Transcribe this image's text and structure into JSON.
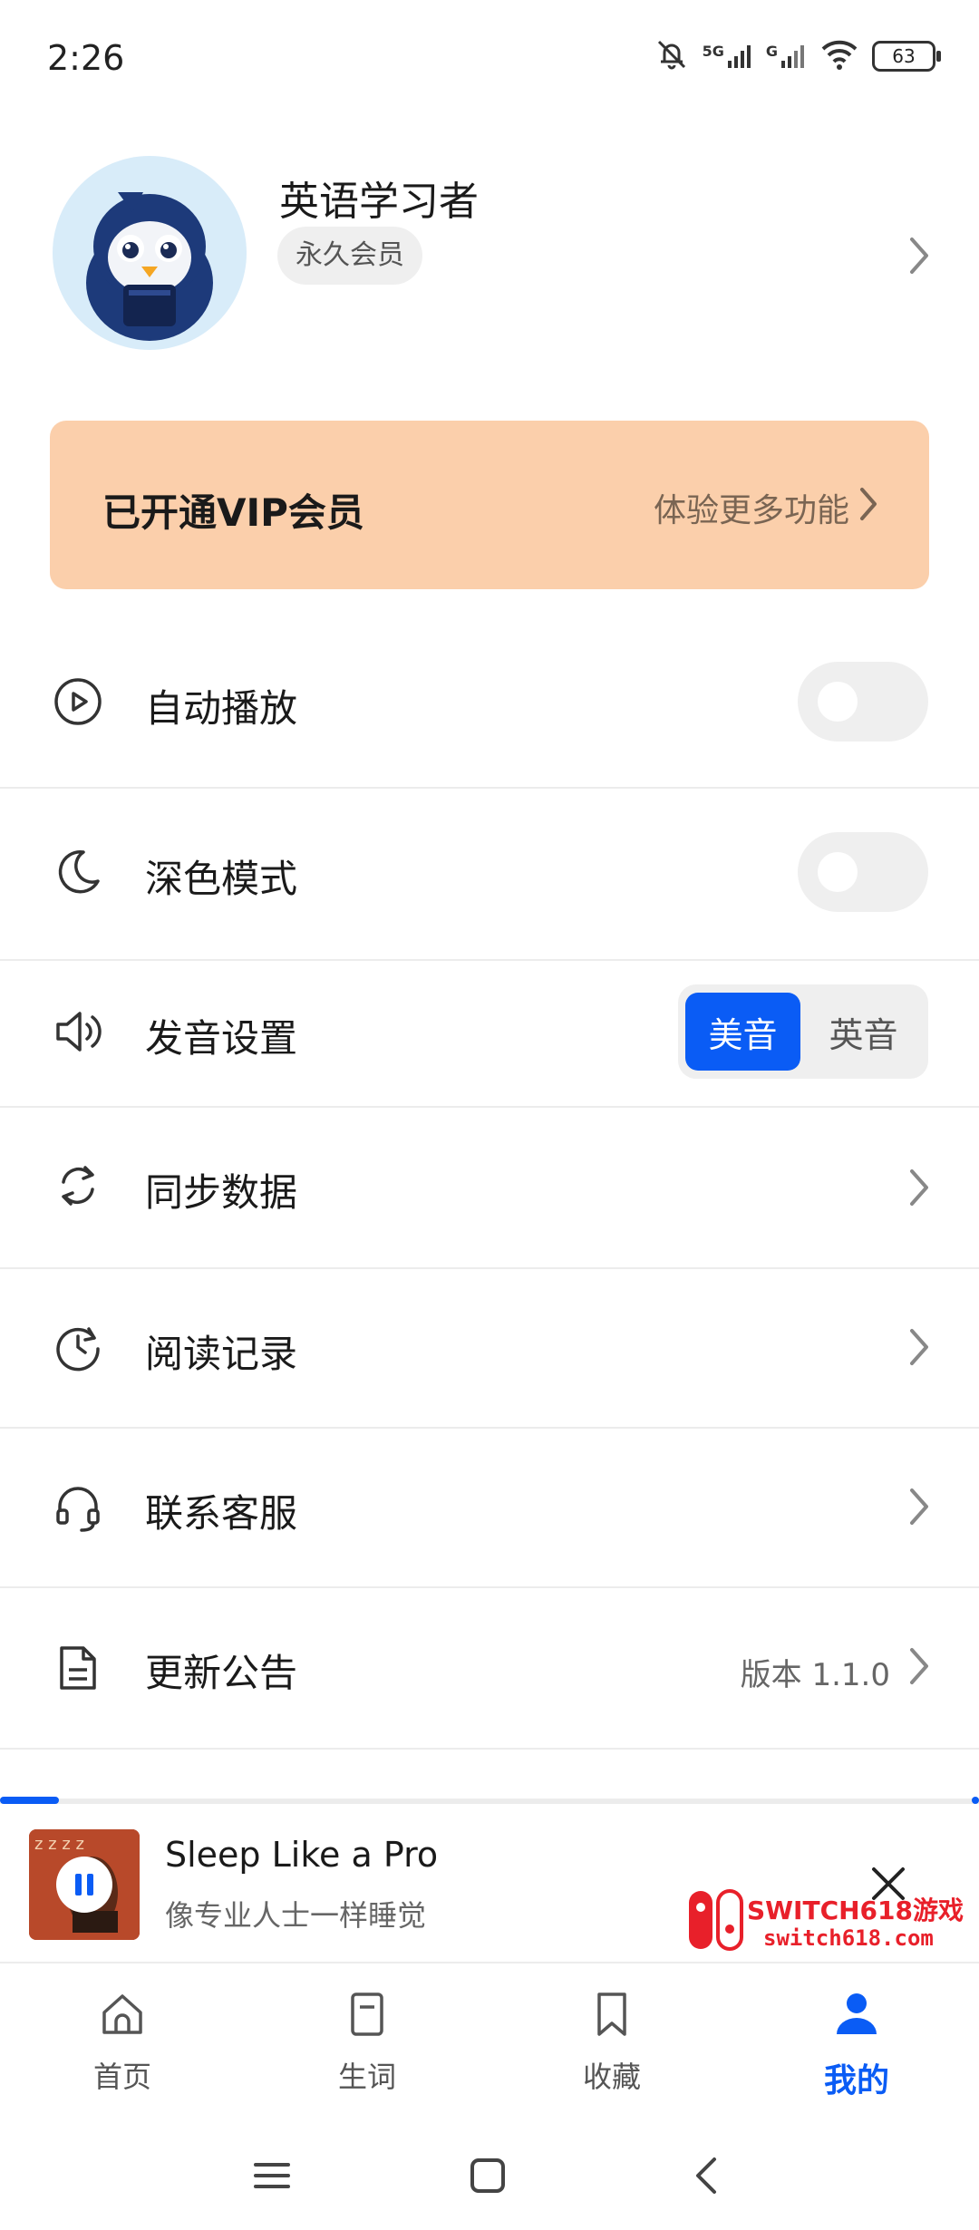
{
  "status_bar": {
    "time": "2:26",
    "network_5g": "5G",
    "network_g": "G",
    "battery": "63"
  },
  "profile": {
    "username": "英语学习者",
    "badge": "永久会员"
  },
  "vip": {
    "title": "已开通VIP会员",
    "link": "体验更多功能",
    "background": "#fbcfab"
  },
  "settings": {
    "autoplay": {
      "label": "自动播放",
      "enabled": false
    },
    "dark_mode": {
      "label": "深色模式",
      "enabled": false
    },
    "pronunciation": {
      "label": "发音设置",
      "options": [
        "美音",
        "英音"
      ],
      "selected": "美音"
    },
    "sync": {
      "label": "同步数据"
    },
    "history": {
      "label": "阅读记录"
    },
    "support": {
      "label": "联系客服"
    },
    "updates": {
      "label": "更新公告",
      "value": "版本 1.1.0"
    }
  },
  "player": {
    "title": "Sleep Like a Pro",
    "subtitle": "像专业人士一样睡觉",
    "progress": 0.06
  },
  "watermark": {
    "line1": "SWITCH618游戏",
    "line2": "switch618.com"
  },
  "tabs": [
    {
      "label": "首页",
      "icon": "home-icon",
      "active": false
    },
    {
      "label": "生词",
      "icon": "notebook-icon",
      "active": false
    },
    {
      "label": "收藏",
      "icon": "bookmark-icon",
      "active": false
    },
    {
      "label": "我的",
      "icon": "person-icon",
      "active": true
    }
  ],
  "colors": {
    "accent": "#0a5cf5",
    "divider": "#ececec"
  }
}
